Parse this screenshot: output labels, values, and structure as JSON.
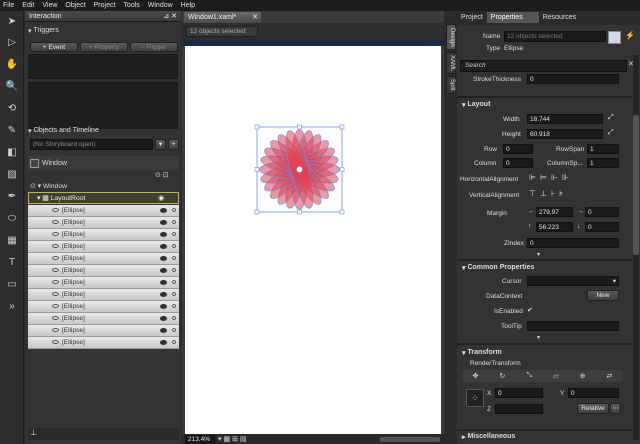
{
  "menu": [
    "File",
    "Edit",
    "View",
    "Object",
    "Project",
    "Tools",
    "Window",
    "Help"
  ],
  "interaction": {
    "title": "Interaction",
    "triggers_label": "Triggers",
    "event_btn": "+ Event",
    "property_btn": "+ Property",
    "trigger_btn": "- Trigger",
    "objects_label": "Objects and Timeline",
    "storyboard": "(No Storyboard open)",
    "window_label": "Window",
    "tree_window": "Window",
    "tree_layoutroot": "LayoutRoot",
    "ellipses": [
      "[Ellipse]",
      "[Ellipse]",
      "[Ellipse]",
      "[Ellipse]",
      "[Ellipse]",
      "[Ellipse]",
      "[Ellipse]",
      "[Ellipse]",
      "[Ellipse]",
      "[Ellipse]",
      "[Ellipse]",
      "[Ellipse]"
    ]
  },
  "document": {
    "tab": "Window1.xaml*",
    "selection_status": "12 objects selected",
    "zoom": "213.4%"
  },
  "side_tabs": [
    "Design",
    "XAML",
    "Split"
  ],
  "properties": {
    "tabs": [
      "Project",
      "Properties",
      "Resources"
    ],
    "name_label": "Name",
    "name_placeholder": "12 objects selected",
    "type_label": "Type",
    "type_value": "Ellipse",
    "search_placeholder": "Search",
    "stroke_label": "StrokeThickness",
    "stroke_value": "0",
    "layout_header": "Layout",
    "width_label": "Width",
    "width_value": "18.744",
    "height_label": "Height",
    "height_value": "60.918",
    "row_label": "Row",
    "row_value": "0",
    "rowspan_label": "RowSpan",
    "rowspan_value": "1",
    "column_label": "Column",
    "column_value": "0",
    "columnspan_label": "ColumnSp...",
    "columnspan_value": "1",
    "halign_label": "HorizontalAlignment",
    "valign_label": "VerticalAlignment",
    "margin_label": "Margin",
    "margin_left": "279.97",
    "margin_right": "0",
    "margin_top": "56.223",
    "margin_bottom": "0",
    "zindex_label": "ZIndex",
    "zindex_value": "0",
    "common_header": "Common Properties",
    "cursor_label": "Cursor",
    "datacontext_label": "DataContext",
    "new_btn": "New",
    "isenabled_label": "IsEnabled",
    "isenabled_check": "✔",
    "tooltip_label": "ToolTip",
    "transform_header": "Transform",
    "render_label": "RenderTransform",
    "x_label": "X",
    "x_value": "0",
    "y_label": "Y",
    "y_value": "0",
    "z_label": "Z",
    "relative_btn": "Relative",
    "misc_header": "Miscellaneous"
  },
  "colors": {
    "accent": "#6a9ad8",
    "ellipse_fill": "#e0434f",
    "ellipse_stroke": "#6a8cf0",
    "canvas": "#ffffff"
  }
}
